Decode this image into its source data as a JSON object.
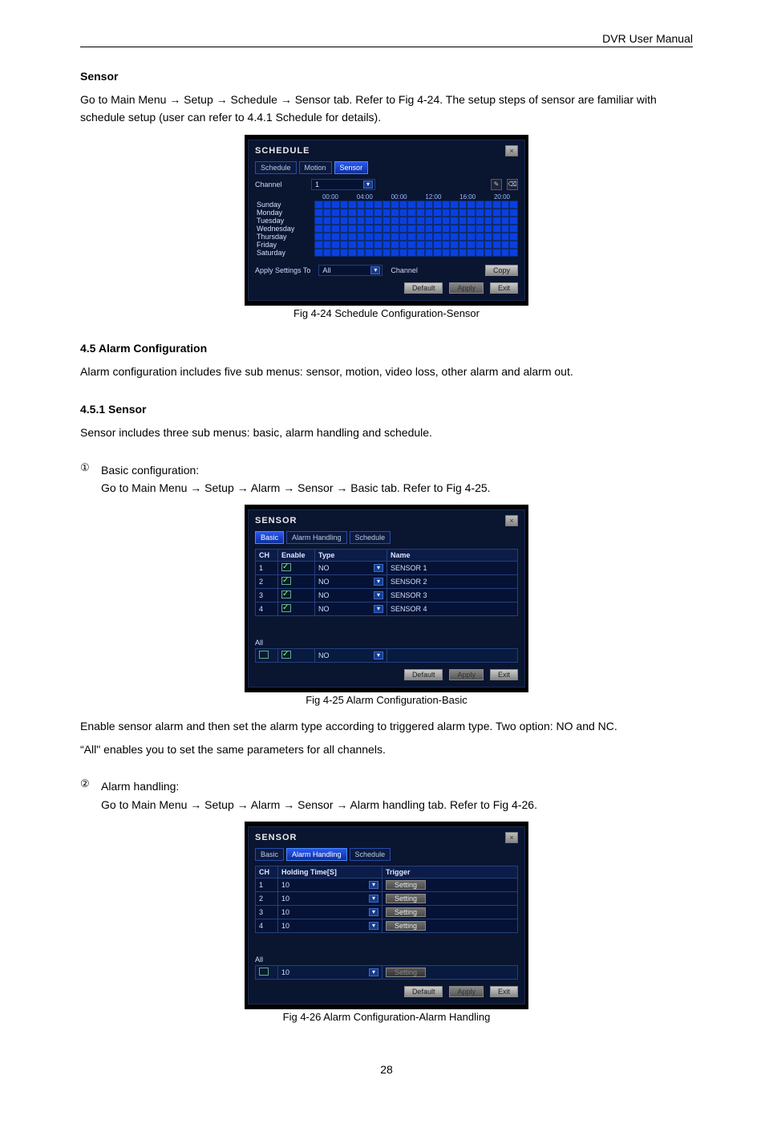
{
  "header": {
    "title": "DVR User Manual"
  },
  "section_sensor_title": "Sensor",
  "sensor_intro_1": "Go to Main Menu",
  "sensor_intro_2": "Setup",
  "sensor_intro_3": "Schedule",
  "sensor_intro_4": "Sensor tab. Refer to Fig 4-24. The setup steps of sensor are familiar with schedule setup (user can refer to 4.4.1 Schedule for details).",
  "fig1": {
    "dialog_title": "SCHEDULE",
    "tabs": [
      "Schedule",
      "Motion",
      "Sensor"
    ],
    "active_tab": 2,
    "channel_label": "Channel",
    "channel_value": "1",
    "times": [
      "00:00",
      "04:00",
      "00:00",
      "12:00",
      "16:00",
      "20:00"
    ],
    "days": [
      "Sunday",
      "Monday",
      "Tuesday",
      "Wednesday",
      "Thursday",
      "Friday",
      "Saturday"
    ],
    "apply_label": "Apply Settings To",
    "apply_value": "All",
    "apply_channel_word": "Channel",
    "copy_btn": "Copy",
    "footer": {
      "default": "Default",
      "apply": "Apply",
      "exit": "Exit"
    },
    "caption": "Fig 4-24 Schedule Configuration-Sensor"
  },
  "alarm_section_title": "4.5 Alarm Configuration",
  "alarm_intro": "Alarm configuration includes five sub menus: sensor, motion, video loss, other alarm and alarm out.",
  "sensor_sub_title": "4.5.1 Sensor",
  "sensor_sub_intro": "Sensor includes three sub menus: basic, alarm handling and schedule.",
  "step1": {
    "bullet": "①",
    "pre": "Basic configuration:",
    "p1": "Go to Main Menu",
    "p2": "Setup",
    "p3": "Alarm",
    "p4": "Sensor",
    "p5": "Basic tab. Refer to Fig 4-25."
  },
  "fig2": {
    "dialog_title": "SENSOR",
    "tabs": [
      "Basic",
      "Alarm Handling",
      "Schedule"
    ],
    "active_tab": 0,
    "cols": [
      "CH",
      "Enable",
      "Type",
      "Name"
    ],
    "rows": [
      {
        "ch": "1",
        "enabled": true,
        "type": "NO",
        "name": "SENSOR 1"
      },
      {
        "ch": "2",
        "enabled": true,
        "type": "NO",
        "name": "SENSOR 2"
      },
      {
        "ch": "3",
        "enabled": true,
        "type": "NO",
        "name": "SENSOR 3"
      },
      {
        "ch": "4",
        "enabled": true,
        "type": "NO",
        "name": "SENSOR 4"
      }
    ],
    "all_label": "All",
    "all_enabled": true,
    "all_type": "NO",
    "footer": {
      "default": "Default",
      "apply": "Apply",
      "exit": "Exit"
    },
    "caption": "Fig 4-25 Alarm Configuration-Basic"
  },
  "basic_p1": "Enable sensor alarm and then set the alarm type according to triggered alarm type. Two option: NO and NC.",
  "basic_p2": "All\" enables you to set the same parameters for all channels.",
  "step2": {
    "bullet": "②",
    "pre": "Alarm handling:",
    "p1": "Go to Main Menu",
    "p2": "Setup",
    "p3": "Alarm",
    "p4": "Sensor",
    "p5": "Alarm handling tab. Refer to Fig 4-26."
  },
  "fig3": {
    "dialog_title": "SENSOR",
    "tabs": [
      "Basic",
      "Alarm Handling",
      "Schedule"
    ],
    "active_tab": 1,
    "cols": [
      "CH",
      "Holding Time[S]",
      "Trigger"
    ],
    "rows": [
      {
        "ch": "1",
        "hold": "10",
        "trigger": "Setting"
      },
      {
        "ch": "2",
        "hold": "10",
        "trigger": "Setting"
      },
      {
        "ch": "3",
        "hold": "10",
        "trigger": "Setting"
      },
      {
        "ch": "4",
        "hold": "10",
        "trigger": "Setting"
      }
    ],
    "all_label": "All",
    "all_hold": "10",
    "all_trigger": "Setting",
    "footer": {
      "default": "Default",
      "apply": "Apply",
      "exit": "Exit"
    },
    "caption": "Fig 4-26 Alarm Configuration-Alarm Handling"
  },
  "page_number": "28"
}
